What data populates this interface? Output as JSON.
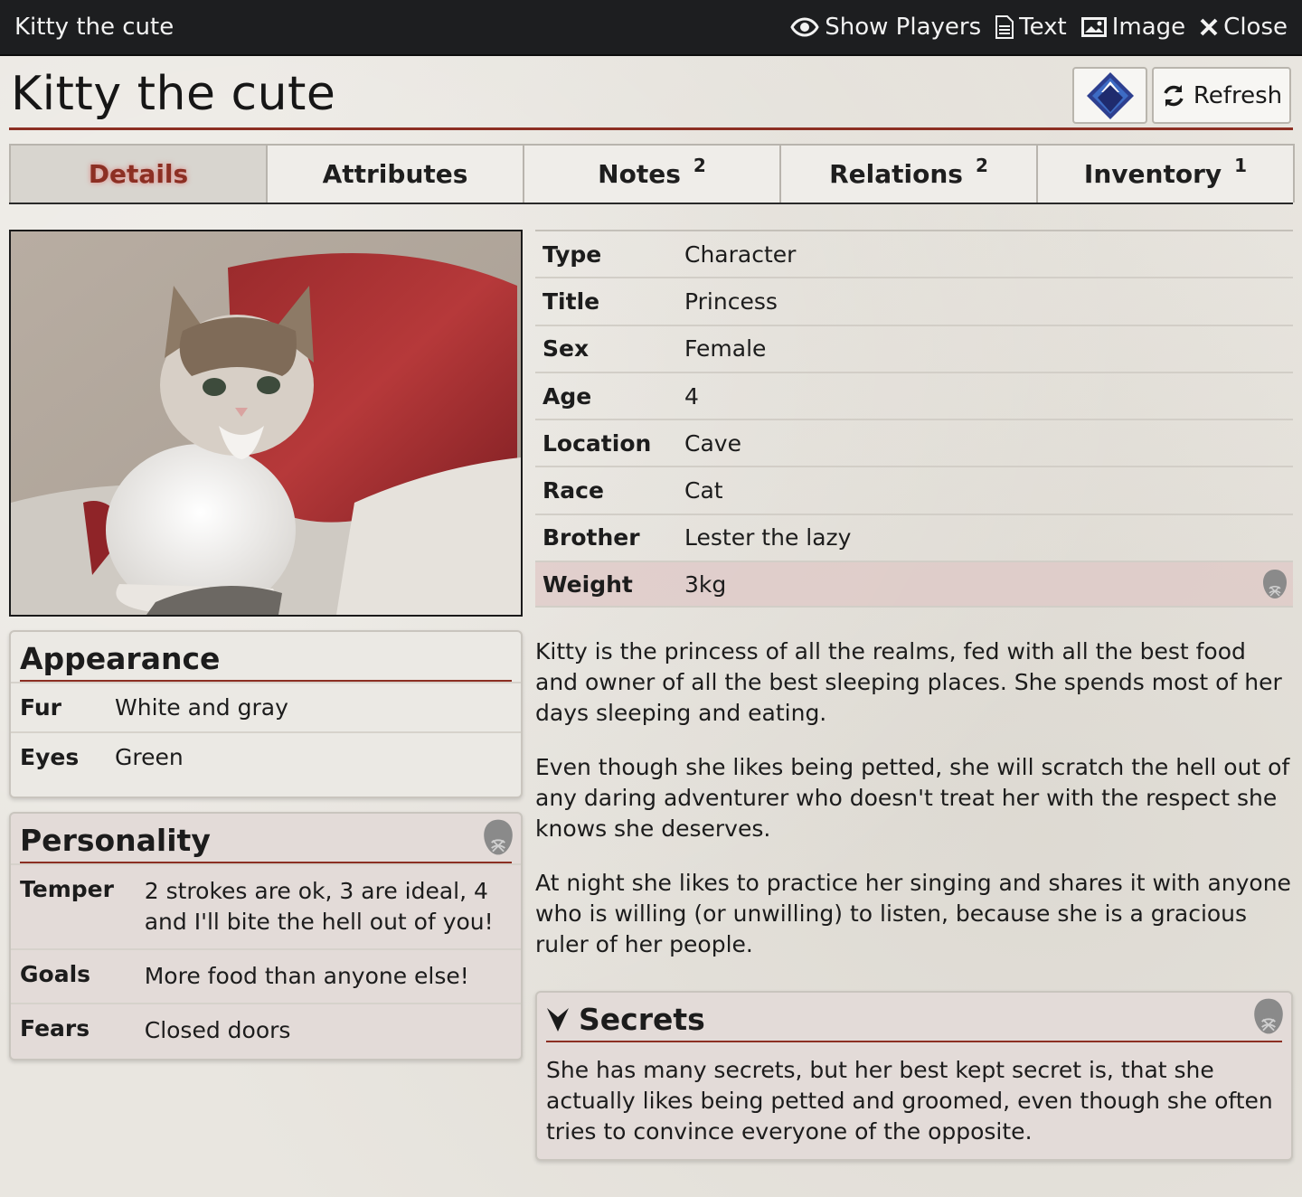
{
  "window": {
    "title": "Kitty the cute",
    "actions": {
      "show_players": "Show Players",
      "text": "Text",
      "image": "Image",
      "close": "Close"
    }
  },
  "header": {
    "title": "Kitty the cute",
    "refresh_label": "Refresh"
  },
  "tabs": [
    {
      "label": "Details",
      "badge": "",
      "active": true
    },
    {
      "label": "Attributes",
      "badge": ""
    },
    {
      "label": "Notes",
      "badge": "2"
    },
    {
      "label": "Relations",
      "badge": "2"
    },
    {
      "label": "Inventory",
      "badge": "1"
    }
  ],
  "attributes": [
    {
      "key": "Type",
      "value": "Character"
    },
    {
      "key": "Title",
      "value": "Princess"
    },
    {
      "key": "Sex",
      "value": "Female"
    },
    {
      "key": "Age",
      "value": "4"
    },
    {
      "key": "Location",
      "value": "Cave"
    },
    {
      "key": "Race",
      "value": "Cat"
    },
    {
      "key": "Brother",
      "value": "Lester the lazy"
    },
    {
      "key": "Weight",
      "value": "3kg",
      "private": true
    }
  ],
  "appearance": {
    "title": "Appearance",
    "rows": [
      {
        "key": "Fur",
        "value": "White and gray"
      },
      {
        "key": "Eyes",
        "value": "Green"
      }
    ]
  },
  "personality": {
    "title": "Personality",
    "rows": [
      {
        "key": "Temper",
        "value": "2 strokes are ok, 3 are ideal, 4 and I'll bite the hell out of you!"
      },
      {
        "key": "Goals",
        "value": "More food than anyone else!"
      },
      {
        "key": "Fears",
        "value": "Closed doors"
      }
    ]
  },
  "entry": [
    "Kitty is the princess of all the realms, fed with all the best food and owner of all the best sleeping places. She spends most of her days sleeping and eating.",
    "Even though she likes being petted, she will scratch the hell out of any daring adventurer who doesn't treat her with the respect she knows she deserves.",
    "At night she likes to practice her singing and shares it with anyone who is willing (or unwilling) to listen, because she is a gracious ruler of her people."
  ],
  "secrets": {
    "title": "Secrets",
    "text": "She has many secrets, but her best kept secret is, that she actually likes being petted and groomed, even though she often tries to convince everyone of the opposite."
  },
  "colors": {
    "accent": "#8c2f23",
    "topbar": "#1d1e20",
    "private_bg": "#e3dbd8"
  }
}
